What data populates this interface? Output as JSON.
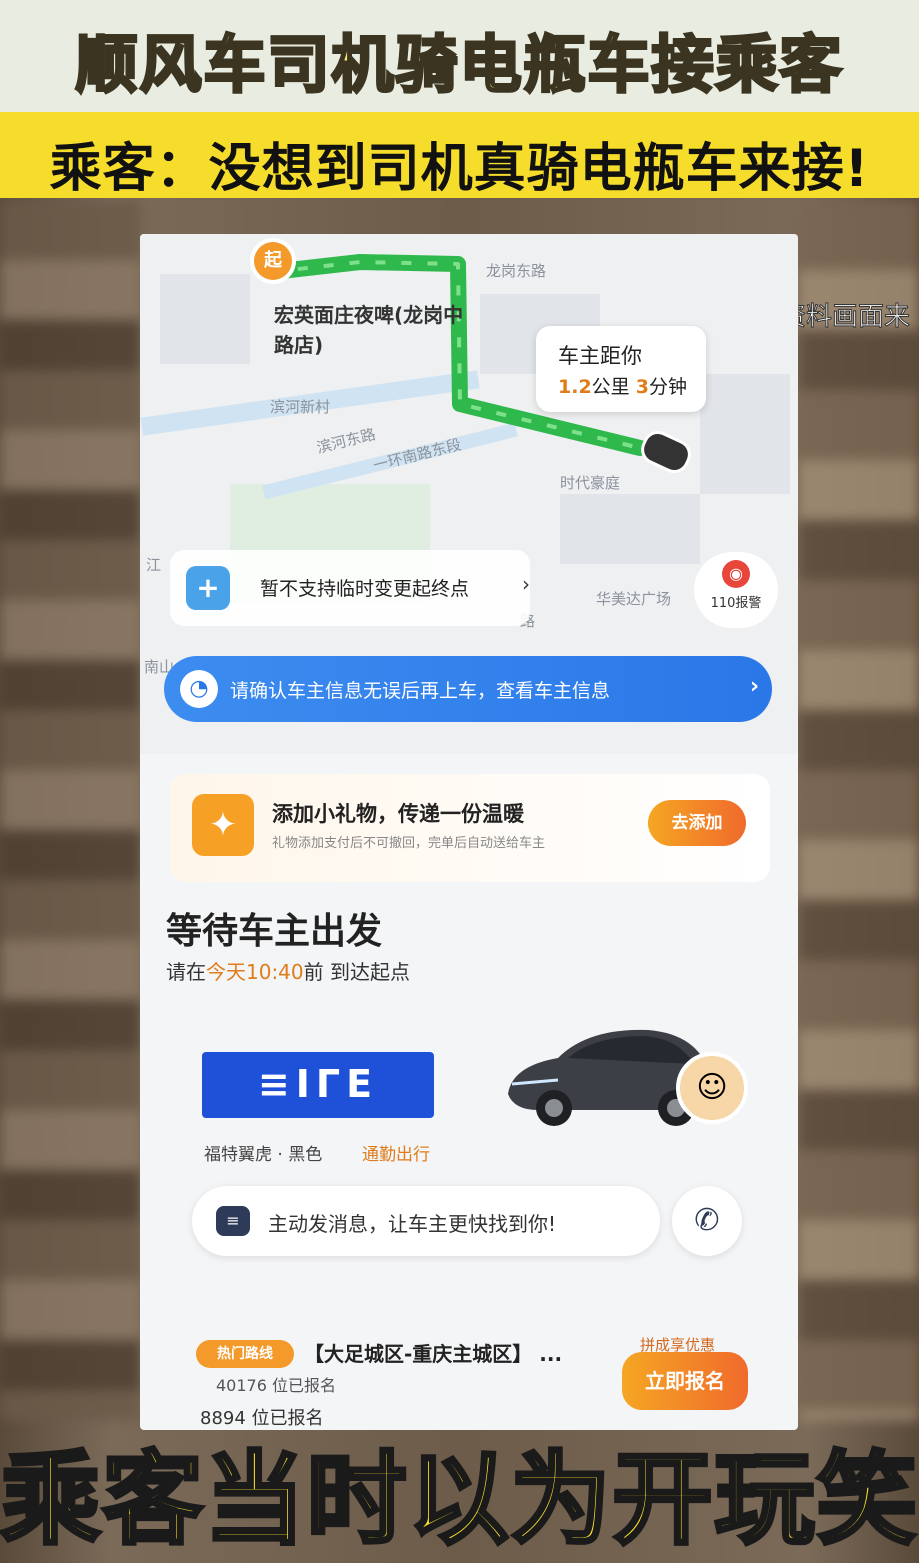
{
  "video": {
    "title": "顺风车司机骑电瓶车接乘客",
    "subtitle": "乘客：没想到司机真骑电瓶车来接!",
    "watermark": "资料画面来",
    "caption": "乘客当时以为开玩笑"
  },
  "map": {
    "start_pin": "起",
    "place_name": "宏英面庄夜啤(龙岗中路店)",
    "labels": [
      "龙岗东路",
      "滨河新村",
      "滨河东路",
      "一环南路东段",
      "时代豪庭",
      "华美达广场",
      "路",
      "江",
      "南山"
    ],
    "driver_distance_title": "车主距你",
    "driver_distance_value": "1.2",
    "driver_distance_unit": "公里",
    "driver_time_value": "3",
    "driver_time_unit": "分钟"
  },
  "notice": {
    "text": "暂不支持临时变更起终点",
    "chevron": "›"
  },
  "alarm": {
    "label": "110报警"
  },
  "confirm_bar": {
    "text": "请确认车主信息无误后再上车，查看车主信息",
    "chevron": "›"
  },
  "gift": {
    "title": "添加小礼物，传递一份温暖",
    "subtitle": "礼物添加支付后不可撤回，完单后自动送给车主",
    "button": "去添加"
  },
  "status": {
    "title": "等待车主出发",
    "sub_prefix": "请在",
    "sub_time": "今天10:40",
    "sub_suffix": "前 到达起点"
  },
  "vehicle": {
    "plate": "≡ΙΓΕ",
    "model": "福特翼虎 · 黑色",
    "tag": "通勤出行"
  },
  "message_bar": {
    "text": "主动发消息，让车主更快找到你!"
  },
  "route": {
    "tag": "热门路线",
    "title": "【大足城区-重庆主城区】 ...",
    "count1": "40176 位已报名",
    "count2": "8894 位已报名",
    "promo": "拼成享优惠",
    "signup": "立即报名"
  }
}
